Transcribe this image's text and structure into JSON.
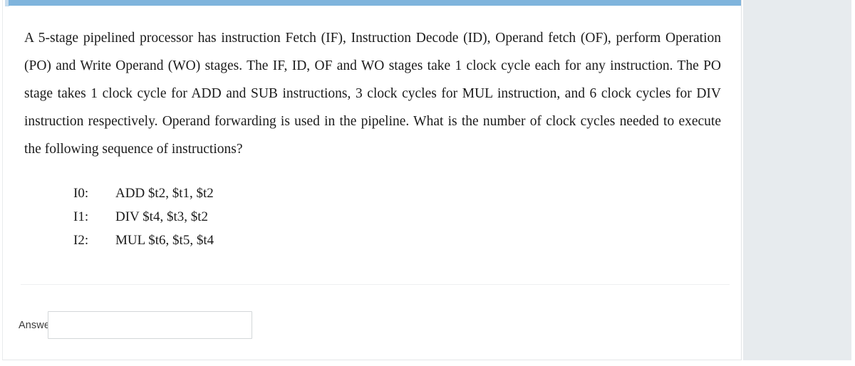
{
  "page": {
    "background_color": "#ffffff",
    "side_panel_color": "#e7ebee",
    "accent_color": "#7fb4dc"
  },
  "question": {
    "prompt": "A 5-stage pipelined processor has instruction Fetch (IF), Instruction Decode (ID), Operand fetch (OF), perform Operation (PO) and Write Operand (WO) stages. The IF, ID, OF and WO stages take 1 clock cycle each for any instruction. The PO stage takes 1 clock cycle for ADD and SUB instructions, 3 clock cycles for MUL instruction, and 6 clock cycles for DIV instruction respectively. Operand forwarding is used in the pipeline. What is the number of clock cycles needed to execute the following sequence of instructions?",
    "instructions": [
      {
        "label": "I0:",
        "text": "ADD $t2, $t1, $t2"
      },
      {
        "label": "I1:",
        "text": "DIV $t4, $t3, $t2"
      },
      {
        "label": "I2:",
        "text": "MUL $t6, $t5, $t4"
      }
    ]
  },
  "answer": {
    "label": "Answer:",
    "value": "",
    "placeholder": ""
  }
}
